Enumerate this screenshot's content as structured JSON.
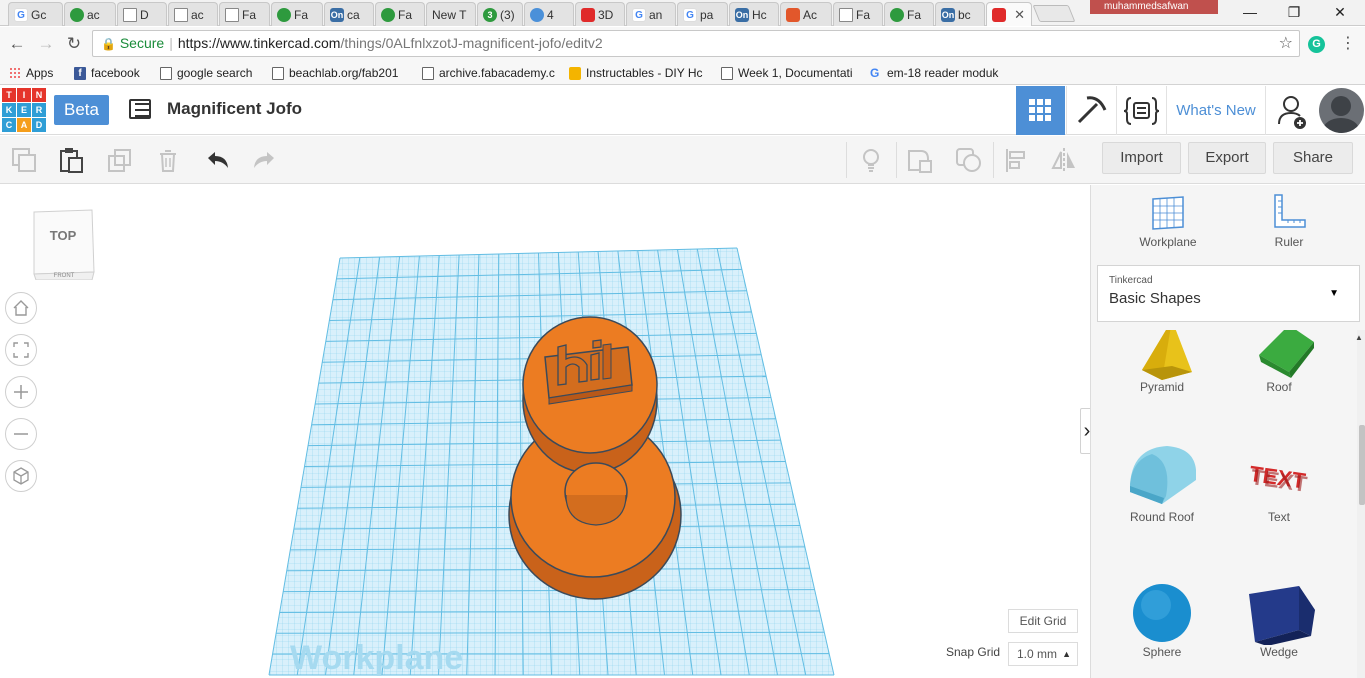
{
  "browser": {
    "tabs": [
      {
        "label": "Gc",
        "icon": "google-icon"
      },
      {
        "label": "ac",
        "icon": "cube-icon"
      },
      {
        "label": "D",
        "icon": "document-icon"
      },
      {
        "label": "ac",
        "icon": "document-icon"
      },
      {
        "label": "Fa",
        "icon": "document-icon"
      },
      {
        "label": "Fa",
        "icon": "wheel-icon"
      },
      {
        "label": "ca",
        "icon": "onshape-icon"
      },
      {
        "label": "Fa",
        "icon": "wheel-icon"
      },
      {
        "label": "New T",
        "icon": "none"
      },
      {
        "label": "(3)",
        "icon": "whatsapp-icon"
      },
      {
        "label": "4",
        "icon": "chat-icon"
      },
      {
        "label": "3D",
        "icon": "tinkercad-icon"
      },
      {
        "label": "an",
        "icon": "google-icon"
      },
      {
        "label": "pa",
        "icon": "google-icon"
      },
      {
        "label": "Hc",
        "icon": "onshape-icon"
      },
      {
        "label": "Ac",
        "icon": "gitlab-icon"
      },
      {
        "label": "Fa",
        "icon": "document-icon"
      },
      {
        "label": "Fa",
        "icon": "wheel-icon"
      },
      {
        "label": "bc",
        "icon": "onshape-icon"
      },
      {
        "label": "",
        "icon": "tinkercad-icon"
      }
    ],
    "user_name": "muhammedsafwan",
    "url_secure_label": "Secure",
    "url_host": "https://www.tinkercad.com",
    "url_path": "/things/0ALfnlxzotJ-magnificent-jofo/editv2",
    "bookmarks": [
      {
        "label": "Apps",
        "icon": "apps-icon"
      },
      {
        "label": "facebook",
        "icon": "facebook-icon"
      },
      {
        "label": "google search",
        "icon": "document-icon"
      },
      {
        "label": "beachlab.org/fab201",
        "icon": "document-icon"
      },
      {
        "label": "archive.fabacademy.c",
        "icon": "document-icon"
      },
      {
        "label": "Instructables - DIY Hc",
        "icon": "instructables-icon"
      },
      {
        "label": "Week 1, Documentati",
        "icon": "document-icon"
      },
      {
        "label": "em-18 reader moduk",
        "icon": "google-icon"
      }
    ]
  },
  "app": {
    "logo_letters": [
      "T",
      "I",
      "N",
      "K",
      "E",
      "R",
      "C",
      "A",
      "D"
    ],
    "logo_colors": [
      "#e5352b",
      "#e5352b",
      "#e5352b",
      "#2f9ed6",
      "#2f9ed6",
      "#2f9ed6",
      "#2f9ed6",
      "#f59e1b",
      "#2f9ed6"
    ],
    "beta_label": "Beta",
    "design_title": "Magnificent Jofo",
    "whats_new_label": "What's New",
    "accent_color": "#4d8fd6"
  },
  "toolbar": {
    "import_label": "Import",
    "export_label": "Export",
    "share_label": "Share"
  },
  "canvas": {
    "viewcube_top": "TOP",
    "viewcube_front": "FRONT",
    "workplane_watermark": "Workplane",
    "edit_grid_label": "Edit Grid",
    "snap_grid_label": "Snap Grid",
    "snap_grid_value": "1.0 mm",
    "shape_color": "#ec7c22",
    "grid_color": "#8fd3ee"
  },
  "panel": {
    "workplane_label": "Workplane",
    "ruler_label": "Ruler",
    "library_category": "Tinkercad",
    "library_name": "Basic Shapes",
    "shapes": [
      {
        "label": "Pyramid",
        "icon": "pyramid-shape-icon"
      },
      {
        "label": "Roof",
        "icon": "roof-shape-icon"
      },
      {
        "label": "Round Roof",
        "icon": "round-roof-shape-icon"
      },
      {
        "label": "Text",
        "icon": "text-shape-icon"
      },
      {
        "label": "Sphere",
        "icon": "sphere-shape-icon"
      },
      {
        "label": "Wedge",
        "icon": "wedge-shape-icon"
      }
    ]
  }
}
